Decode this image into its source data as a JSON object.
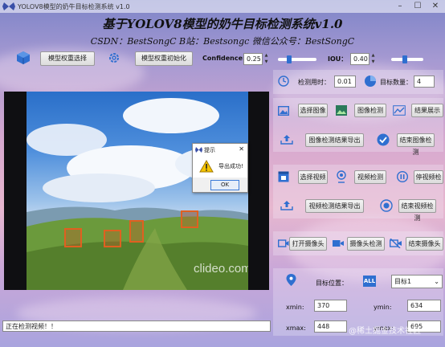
{
  "window": {
    "title": "YOLOV8模型的奶牛目标检测系统 v1.0",
    "minimize": "–",
    "maximize": "☐",
    "close": "✕"
  },
  "header": {
    "title": "基于YOLOV8模型的奶牛目标检测系统v1.0",
    "subtitle": "CSDN：BestSongC   B站：Bestsongc   微信公众号：BestSongC"
  },
  "toolbar": {
    "select_weights": "模型权重选择",
    "init_weights": "模型权重初始化",
    "confidence_label": "Confidence:",
    "confidence_value": "0.25",
    "iou_label": "IOU：",
    "iou_value": "0.40",
    "confidence_level": 0.25,
    "iou_level": 0.4
  },
  "stats": {
    "time_label": "检测用时：",
    "time_value": "0.01",
    "count_label": "目标数量：",
    "count_value": "4"
  },
  "image_section": {
    "select_image": "选择图像",
    "detect_image": "图像检测",
    "show_result": "结果展示",
    "export_result": "图像检测结果导出",
    "end_detect": "结束图像检测"
  },
  "video_section": {
    "select_video": "选择视频",
    "detect_video": "视频检测",
    "pause_video": "停视频检",
    "export_result": "视频检测结果导出",
    "end_detect": "结束视频检测"
  },
  "camera_section": {
    "open_camera": "打开摄像头",
    "detect_camera": "摄像头检测",
    "close_camera": "结束摄像头"
  },
  "target": {
    "position_label": "目标位置：",
    "all_badge": "ALL",
    "selected": "目标1",
    "xmin_label": "xmin:",
    "xmin_value": "370",
    "ymin_label": "ymin:",
    "ymin_value": "634",
    "xmax_label": "xmax:",
    "xmax_value": "448",
    "ymax_label": "ymax:",
    "ymax_value": "695"
  },
  "viewer": {
    "watermark": "clideo.com"
  },
  "dialog": {
    "title": "提示",
    "message": "导出成功!",
    "ok": "OK",
    "close": "✕"
  },
  "status": {
    "text": "正在检测视频！！"
  },
  "footer_watermark": "@稀土掘金技术社区",
  "colors": {
    "accent": "#2f6fd0",
    "detection_box": "#e06020"
  }
}
